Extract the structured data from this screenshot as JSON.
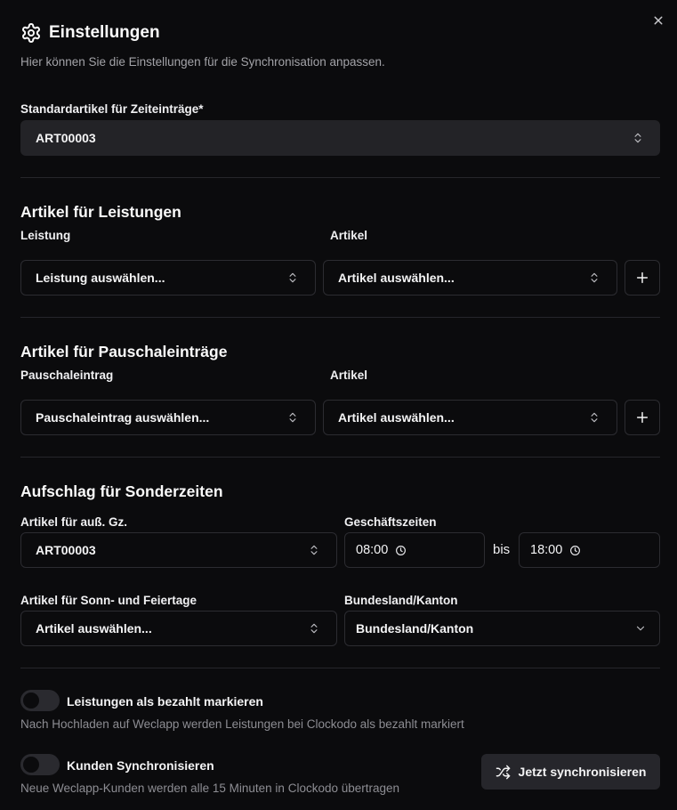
{
  "dialog": {
    "title": "Einstellungen",
    "description": "Hier können Sie die Einstellungen für die Synchronisation anpassen."
  },
  "default_article": {
    "label": "Standardartikel für Zeiteinträge*",
    "value": "ART00003"
  },
  "services": {
    "title": "Artikel für Leistungen",
    "service_label": "Leistung",
    "article_label": "Artikel",
    "service_placeholder": "Leistung auswählen...",
    "article_placeholder": "Artikel auswählen..."
  },
  "flat_rates": {
    "title": "Artikel für Pauschaleinträge",
    "entry_label": "Pauschaleintrag",
    "article_label": "Artikel",
    "entry_placeholder": "Pauschaleintrag auswählen...",
    "article_placeholder": "Artikel auswählen..."
  },
  "surcharge": {
    "title": "Aufschlag für Sonderzeiten",
    "outside_hours_label": "Artikel für auß. Gz.",
    "outside_hours_value": "ART00003",
    "business_hours_label": "Geschäftszeiten",
    "from_time": "08:00",
    "to_word": "bis",
    "to_time": "18:00",
    "holidays_label": "Artikel für Sonn- und Feiertage",
    "holidays_placeholder": "Artikel auswählen...",
    "region_label": "Bundesland/Kanton",
    "region_value": "Bundesland/Kanton"
  },
  "toggles": [
    {
      "label": "Leistungen als bezahlt markieren",
      "description": "Nach Hochladen auf Weclapp werden Leistungen bei Clockodo als bezahlt markiert",
      "enabled": false
    },
    {
      "label": "Kunden Synchronisieren",
      "description": "Neue Weclapp-Kunden werden alle 15 Minuten in Clockodo übertragen",
      "enabled": false
    }
  ],
  "sync_button": {
    "label": "Jetzt synchronisieren"
  },
  "icons": {
    "header": "gear-icon",
    "close": "close-icon",
    "select": "chevron-up-down-icon",
    "dropdown": "chevron-down-icon",
    "add": "plus-icon",
    "time": "clock-icon",
    "sync": "shuffle-icon"
  }
}
